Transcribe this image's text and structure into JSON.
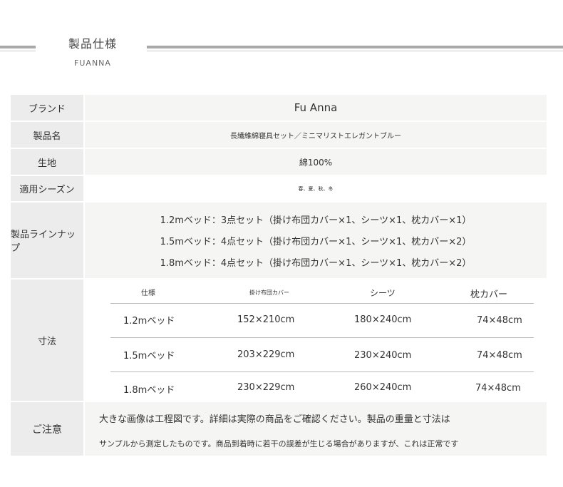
{
  "header": {
    "title": "製品仕様",
    "subtitle": "FUANNA"
  },
  "specs": {
    "brand": {
      "label": "ブランド",
      "value": "Fu Anna"
    },
    "product_name": {
      "label": "製品名",
      "value": "長繊維綿寝具セット／ミニマリストエレガントブルー"
    },
    "fabric": {
      "label": "生地",
      "value": "綿100%"
    },
    "season": {
      "label": "適用シーズン",
      "value": "春、夏、秋、冬"
    },
    "lineup": {
      "label": "製品ラインナップ",
      "items": [
        "1.2mベッド：3点セット（掛け布団カバー×1、シーツ×1、枕カバー×1）",
        "1.5mベッド：4点セット（掛け布団カバー×1、シーツ×1、枕カバー×2）",
        "1.8mベッド：4点セット（掛け布団カバー×1、シーツ×1、枕カバー×2）"
      ]
    },
    "size": {
      "label": "寸法",
      "headers": [
        "仕様",
        "掛け布団カバー",
        "シーツ",
        "枕カバー"
      ],
      "rows": [
        [
          "1.2mベッド",
          "152×210cm",
          "180×240cm",
          "74×48cm"
        ],
        [
          "1.5mベッド",
          "203×229cm",
          "230×240cm",
          "74×48cm"
        ],
        [
          "1.8mベッド",
          "230×229cm",
          "260×240cm",
          "74×48cm"
        ]
      ]
    },
    "notice": {
      "label": "ご注意",
      "lines": [
        "大きな画像は工程図です。詳細は実際の商品をご確認ください。製品の重量と寸法は",
        "サンプルから測定したものです。商品到着時に若干の誤差が生じる場合がありますが、これは正常です"
      ]
    }
  }
}
